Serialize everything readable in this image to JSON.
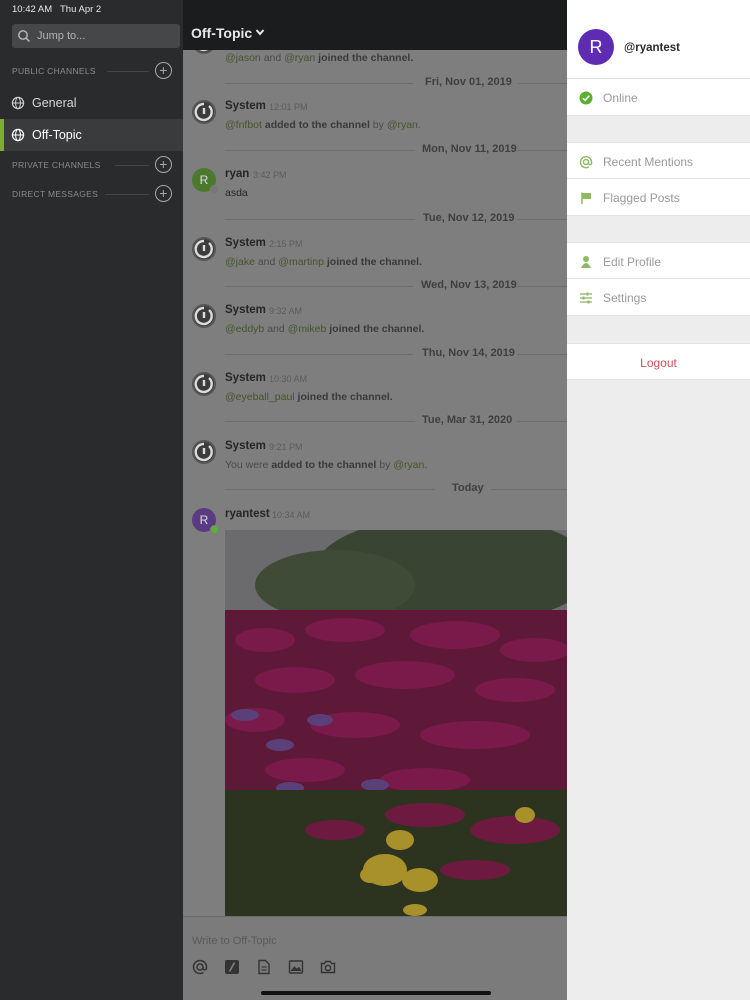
{
  "status_bar": {
    "time": "10:42 AM",
    "date": "Thu Apr 2"
  },
  "sidebar": {
    "jump_placeholder": "Jump to...",
    "sections": {
      "public": "PUBLIC CHANNELS",
      "private": "PRIVATE CHANNELS",
      "direct": "DIRECT MESSAGES"
    },
    "channels": [
      "General",
      "Off-Topic"
    ],
    "active_channel": "Off-Topic",
    "accent_color": "#7fab2f"
  },
  "header": {
    "channel_title": "Off-Topic"
  },
  "messages": {
    "partial": {
      "u1": "@jason",
      "and": "and",
      "u2": "@ryan",
      "action": "joined the channel."
    },
    "dates": [
      "Fri, Nov 01, 2019",
      "Mon, Nov 11, 2019",
      "Tue, Nov 12, 2019",
      "Wed, Nov 13, 2019",
      "Thu, Nov 14, 2019",
      "Tue, Mar 31, 2020",
      "Today"
    ],
    "posts": [
      {
        "user": "System",
        "time": "12:01 PM",
        "mention": "@fnfbot",
        "action": "added to the channel",
        "by": "by",
        "by_user": "@ryan."
      },
      {
        "user": "ryan",
        "time": "3:42 PM",
        "text": "asda"
      },
      {
        "user": "System",
        "time": "2:15 PM",
        "mention": "@jake",
        "and": "and",
        "mention2": "@martinp",
        "action": "joined the channel."
      },
      {
        "user": "System",
        "time": "9:32 AM",
        "mention": "@eddyb",
        "and": "and",
        "mention2": "@mikeb",
        "action": "joined the channel."
      },
      {
        "user": "System",
        "time": "10:30 AM",
        "mention": "@eyeball_paul",
        "action": "joined the channel."
      },
      {
        "user": "System",
        "time": "9:21 PM",
        "prefix": "You were",
        "action": "added to the channel",
        "by": "by",
        "by_user": "@ryan."
      },
      {
        "user": "ryantest",
        "time": "10:34 AM"
      }
    ]
  },
  "input": {
    "placeholder": "Write to Off-Topic"
  },
  "drawer": {
    "avatar_letter": "R",
    "username": "@ryantest",
    "status": "Online",
    "items": [
      "Recent Mentions",
      "Flagged Posts",
      "Edit Profile",
      "Settings"
    ],
    "logout": "Logout",
    "online_color": "#5cb030",
    "logout_color": "#d14d5a"
  },
  "avatars": {
    "ryan": "R",
    "ryantest": "R"
  }
}
